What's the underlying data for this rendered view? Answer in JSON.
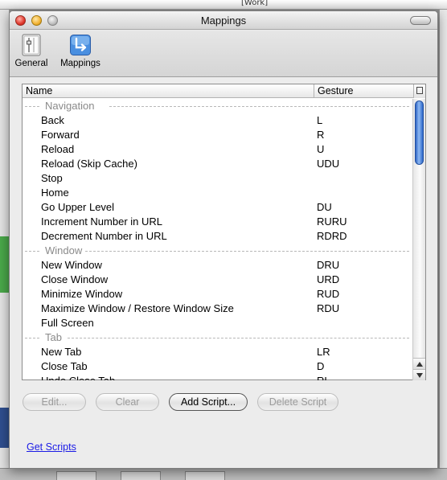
{
  "desktop": {
    "menubar_extra": "[Work]"
  },
  "window": {
    "title": "Mappings"
  },
  "toolbar": {
    "items": [
      {
        "label": "General",
        "icon": "switch-icon"
      },
      {
        "label": "Mappings",
        "icon": "mapping-arrow-icon"
      }
    ]
  },
  "table": {
    "columns": {
      "name": "Name",
      "gesture": "Gesture"
    },
    "rows": [
      {
        "type": "group",
        "name": "Navigation",
        "gesture": ""
      },
      {
        "type": "item",
        "name": "Back",
        "gesture": "L"
      },
      {
        "type": "item",
        "name": "Forward",
        "gesture": "R"
      },
      {
        "type": "item",
        "name": "Reload",
        "gesture": "U"
      },
      {
        "type": "item",
        "name": "Reload (Skip Cache)",
        "gesture": "UDU"
      },
      {
        "type": "item",
        "name": "Stop",
        "gesture": ""
      },
      {
        "type": "item",
        "name": "Home",
        "gesture": ""
      },
      {
        "type": "item",
        "name": "Go Upper Level",
        "gesture": "DU"
      },
      {
        "type": "item",
        "name": "Increment Number in URL",
        "gesture": "RURU"
      },
      {
        "type": "item",
        "name": "Decrement Number in URL",
        "gesture": "RDRD"
      },
      {
        "type": "group",
        "name": "Window",
        "gesture": ""
      },
      {
        "type": "item",
        "name": "New Window",
        "gesture": "DRU"
      },
      {
        "type": "item",
        "name": "Close Window",
        "gesture": "URD"
      },
      {
        "type": "item",
        "name": "Minimize Window",
        "gesture": "RUD"
      },
      {
        "type": "item",
        "name": "Maximize Window / Restore Window Size",
        "gesture": "RDU"
      },
      {
        "type": "item",
        "name": "Full Screen",
        "gesture": ""
      },
      {
        "type": "group",
        "name": "Tab",
        "gesture": ""
      },
      {
        "type": "item",
        "name": "New Tab",
        "gesture": "LR"
      },
      {
        "type": "item",
        "name": "Close Tab",
        "gesture": "D"
      },
      {
        "type": "item",
        "name": "Undo Close Tab",
        "gesture": "RL"
      }
    ]
  },
  "buttons": {
    "edit": "Edit...",
    "clear": "Clear",
    "add_script": "Add Script...",
    "delete_script": "Delete Script"
  },
  "links": {
    "get_scripts": "Get Scripts"
  }
}
